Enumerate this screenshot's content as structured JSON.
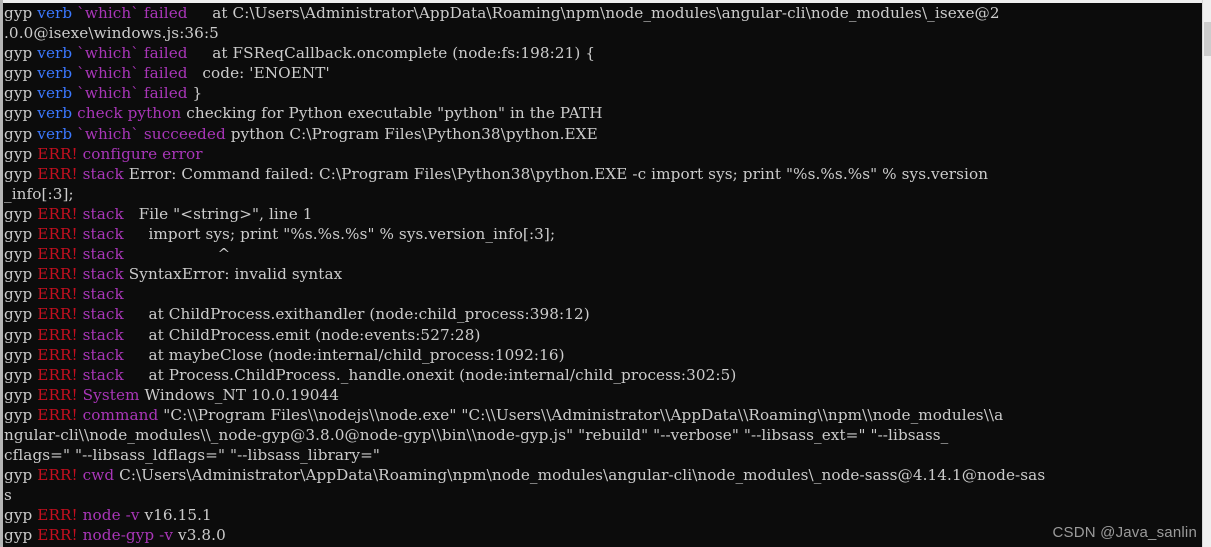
{
  "terminal": {
    "background_color": "#0c0c0c",
    "default_text_color": "#cccccc",
    "palette": {
      "prefix": "#cccccc",
      "verb": "#3b78ff",
      "err": "#c50f1f",
      "tag": "#a936b8"
    },
    "prefix_label": "gyp",
    "level_verb": "verb",
    "level_err": "ERR!",
    "scrollbar": {
      "track_color": "#f0f0f0",
      "thumb_color": "#cdcdcd"
    },
    "lines": [
      {
        "segments": [
          {
            "style": "prefix",
            "text": "gyp "
          },
          {
            "style": "verb",
            "text": "verb "
          },
          {
            "style": "tag",
            "text": "`which` failed"
          },
          {
            "style": "plain",
            "text": "     at C:\\Users\\Administrator\\AppData\\Roaming\\npm\\node_modules\\angular-cli\\node_modules\\_isexe@2"
          }
        ]
      },
      {
        "segments": [
          {
            "style": "plain",
            "text": ".0.0@isexe\\windows.js:36:5"
          }
        ]
      },
      {
        "segments": [
          {
            "style": "prefix",
            "text": "gyp "
          },
          {
            "style": "verb",
            "text": "verb "
          },
          {
            "style": "tag",
            "text": "`which` failed"
          },
          {
            "style": "plain",
            "text": "     at FSReqCallback.oncomplete (node:fs:198:21) {"
          }
        ]
      },
      {
        "segments": [
          {
            "style": "prefix",
            "text": "gyp "
          },
          {
            "style": "verb",
            "text": "verb "
          },
          {
            "style": "tag",
            "text": "`which` failed"
          },
          {
            "style": "plain",
            "text": "   code: 'ENOENT'"
          }
        ]
      },
      {
        "segments": [
          {
            "style": "prefix",
            "text": "gyp "
          },
          {
            "style": "verb",
            "text": "verb "
          },
          {
            "style": "tag",
            "text": "`which` failed"
          },
          {
            "style": "plain",
            "text": " }"
          }
        ]
      },
      {
        "segments": [
          {
            "style": "prefix",
            "text": "gyp "
          },
          {
            "style": "verb",
            "text": "verb "
          },
          {
            "style": "tag",
            "text": "check python"
          },
          {
            "style": "plain",
            "text": " checking for Python executable \"python\" in the PATH"
          }
        ]
      },
      {
        "segments": [
          {
            "style": "prefix",
            "text": "gyp "
          },
          {
            "style": "verb",
            "text": "verb "
          },
          {
            "style": "tag",
            "text": "`which` succeeded"
          },
          {
            "style": "plain",
            "text": " python C:\\Program Files\\Python38\\python.EXE"
          }
        ]
      },
      {
        "segments": [
          {
            "style": "prefix",
            "text": "gyp "
          },
          {
            "style": "err",
            "text": "ERR! "
          },
          {
            "style": "tag",
            "text": "configure error"
          }
        ]
      },
      {
        "segments": [
          {
            "style": "prefix",
            "text": "gyp "
          },
          {
            "style": "err",
            "text": "ERR! "
          },
          {
            "style": "tag",
            "text": "stack"
          },
          {
            "style": "plain",
            "text": " Error: Command failed: C:\\Program Files\\Python38\\python.EXE -c import sys; print \"%s.%s.%s\" % sys.version"
          }
        ]
      },
      {
        "segments": [
          {
            "style": "plain",
            "text": "_info[:3];"
          }
        ]
      },
      {
        "segments": [
          {
            "style": "prefix",
            "text": "gyp "
          },
          {
            "style": "err",
            "text": "ERR! "
          },
          {
            "style": "tag",
            "text": "stack"
          },
          {
            "style": "plain",
            "text": "   File \"<string>\", line 1"
          }
        ]
      },
      {
        "segments": [
          {
            "style": "prefix",
            "text": "gyp "
          },
          {
            "style": "err",
            "text": "ERR! "
          },
          {
            "style": "tag",
            "text": "stack"
          },
          {
            "style": "plain",
            "text": "     import sys; print \"%s.%s.%s\" % sys.version_info[:3];"
          }
        ]
      },
      {
        "segments": [
          {
            "style": "prefix",
            "text": "gyp "
          },
          {
            "style": "err",
            "text": "ERR! "
          },
          {
            "style": "tag",
            "text": "stack"
          },
          {
            "style": "plain",
            "text": "                   ^"
          }
        ]
      },
      {
        "segments": [
          {
            "style": "prefix",
            "text": "gyp "
          },
          {
            "style": "err",
            "text": "ERR! "
          },
          {
            "style": "tag",
            "text": "stack"
          },
          {
            "style": "plain",
            "text": " SyntaxError: invalid syntax"
          }
        ]
      },
      {
        "segments": [
          {
            "style": "prefix",
            "text": "gyp "
          },
          {
            "style": "err",
            "text": "ERR! "
          },
          {
            "style": "tag",
            "text": "stack"
          }
        ]
      },
      {
        "segments": [
          {
            "style": "prefix",
            "text": "gyp "
          },
          {
            "style": "err",
            "text": "ERR! "
          },
          {
            "style": "tag",
            "text": "stack"
          },
          {
            "style": "plain",
            "text": "     at ChildProcess.exithandler (node:child_process:398:12)"
          }
        ]
      },
      {
        "segments": [
          {
            "style": "prefix",
            "text": "gyp "
          },
          {
            "style": "err",
            "text": "ERR! "
          },
          {
            "style": "tag",
            "text": "stack"
          },
          {
            "style": "plain",
            "text": "     at ChildProcess.emit (node:events:527:28)"
          }
        ]
      },
      {
        "segments": [
          {
            "style": "prefix",
            "text": "gyp "
          },
          {
            "style": "err",
            "text": "ERR! "
          },
          {
            "style": "tag",
            "text": "stack"
          },
          {
            "style": "plain",
            "text": "     at maybeClose (node:internal/child_process:1092:16)"
          }
        ]
      },
      {
        "segments": [
          {
            "style": "prefix",
            "text": "gyp "
          },
          {
            "style": "err",
            "text": "ERR! "
          },
          {
            "style": "tag",
            "text": "stack"
          },
          {
            "style": "plain",
            "text": "     at Process.ChildProcess._handle.onexit (node:internal/child_process:302:5)"
          }
        ]
      },
      {
        "segments": [
          {
            "style": "prefix",
            "text": "gyp "
          },
          {
            "style": "err",
            "text": "ERR! "
          },
          {
            "style": "tag",
            "text": "System"
          },
          {
            "style": "plain",
            "text": " Windows_NT 10.0.19044"
          }
        ]
      },
      {
        "segments": [
          {
            "style": "prefix",
            "text": "gyp "
          },
          {
            "style": "err",
            "text": "ERR! "
          },
          {
            "style": "tag",
            "text": "command"
          },
          {
            "style": "plain",
            "text": " \"C:\\\\Program Files\\\\nodejs\\\\node.exe\" \"C:\\\\Users\\\\Administrator\\\\AppData\\\\Roaming\\\\npm\\\\node_modules\\\\a"
          }
        ]
      },
      {
        "segments": [
          {
            "style": "plain",
            "text": "ngular-cli\\\\node_modules\\\\_node-gyp@3.8.0@node-gyp\\\\bin\\\\node-gyp.js\" \"rebuild\" \"--verbose\" \"--libsass_ext=\" \"--libsass_"
          }
        ]
      },
      {
        "segments": [
          {
            "style": "plain",
            "text": "cflags=\" \"--libsass_ldflags=\" \"--libsass_library=\""
          }
        ]
      },
      {
        "segments": [
          {
            "style": "prefix",
            "text": "gyp "
          },
          {
            "style": "err",
            "text": "ERR! "
          },
          {
            "style": "tag",
            "text": "cwd"
          },
          {
            "style": "plain",
            "text": " C:\\Users\\Administrator\\AppData\\Roaming\\npm\\node_modules\\angular-cli\\node_modules\\_node-sass@4.14.1@node-sas"
          }
        ]
      },
      {
        "segments": [
          {
            "style": "plain",
            "text": "s"
          }
        ]
      },
      {
        "segments": [
          {
            "style": "prefix",
            "text": "gyp "
          },
          {
            "style": "err",
            "text": "ERR! "
          },
          {
            "style": "tag",
            "text": "node -v"
          },
          {
            "style": "plain",
            "text": " v16.15.1"
          }
        ]
      },
      {
        "segments": [
          {
            "style": "prefix",
            "text": "gyp "
          },
          {
            "style": "err",
            "text": "ERR! "
          },
          {
            "style": "tag",
            "text": "node-gyp -v"
          },
          {
            "style": "plain",
            "text": " v3.8.0"
          }
        ]
      }
    ]
  },
  "watermark": {
    "text": "CSDN @Java_sanlin",
    "color": "#9b9b9b"
  }
}
